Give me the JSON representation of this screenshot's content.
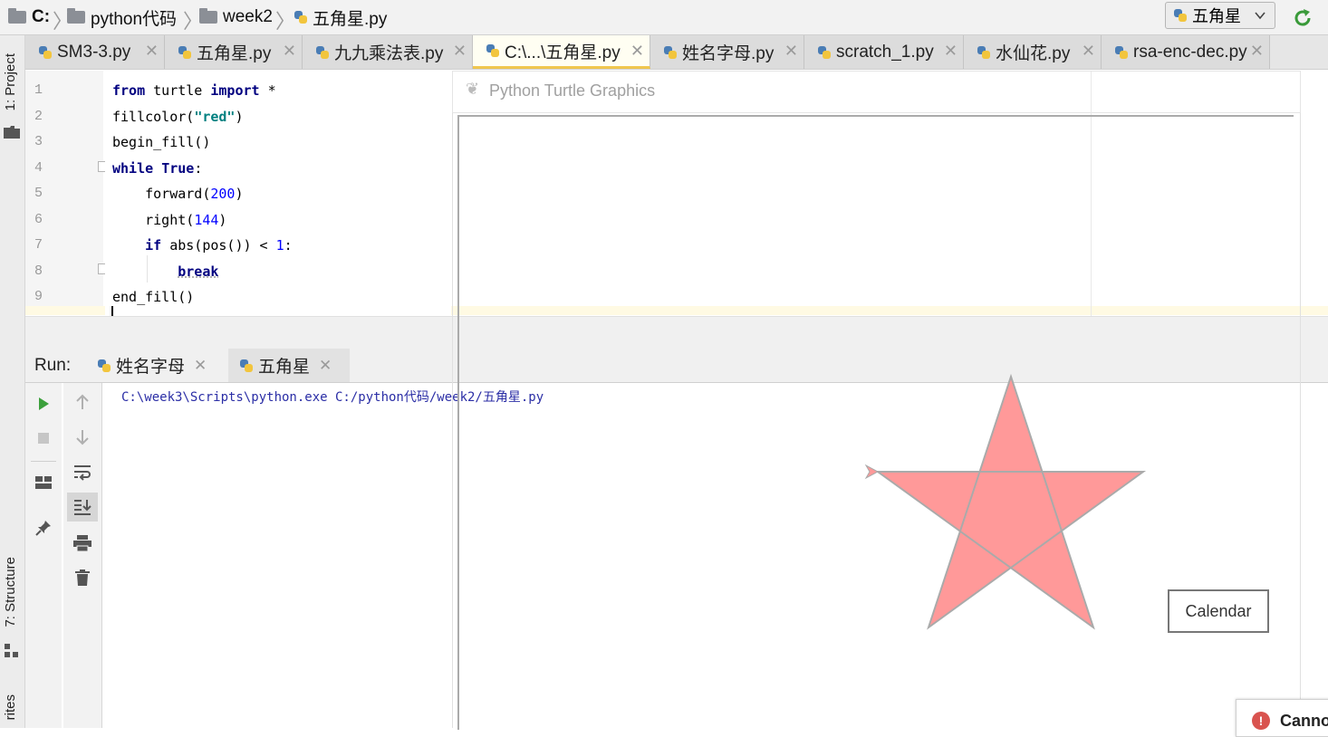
{
  "navbar": {
    "crumbs": [
      "C:",
      "python代码",
      "week2",
      "五角星.py"
    ],
    "run_config": "五角星"
  },
  "left_strip": {
    "project": "1: Project",
    "structure": "7: Structure",
    "favorites": "rites"
  },
  "tabs": [
    {
      "label": "SM3-3.py"
    },
    {
      "label": "五角星.py"
    },
    {
      "label": "九九乘法表.py"
    },
    {
      "label": "C:\\...\\五角星.py"
    },
    {
      "label": "姓名字母.py"
    },
    {
      "label": "scratch_1.py"
    },
    {
      "label": "水仙花.py"
    },
    {
      "label": "rsa-enc-dec.py"
    }
  ],
  "editor": {
    "line_numbers": [
      "1",
      "2",
      "3",
      "4",
      "5",
      "6",
      "7",
      "8",
      "9"
    ],
    "lines": {
      "l1": {
        "kw1": "from",
        "mid": " turtle ",
        "kw2": "import",
        "end": " *"
      },
      "l2": {
        "fn": "fillcolor(",
        "str": "\"red\"",
        "end": ")"
      },
      "l3": {
        "fn": "begin_fill()"
      },
      "l4": {
        "kw1": "while",
        "sp": " ",
        "kw2": "True",
        "end": ":"
      },
      "l5": {
        "fn": "    forward(",
        "num": "200",
        "end": ")"
      },
      "l6": {
        "fn": "    right(",
        "num": "144",
        "end": ")"
      },
      "l7": {
        "pre": "    ",
        "kw": "if",
        "mid": " abs(pos()) < ",
        "num": "1",
        "end": ":"
      },
      "l8": {
        "pre": "        ",
        "kw": "break"
      },
      "l9": {
        "fn": "end_fill()"
      }
    }
  },
  "run": {
    "label": "Run:",
    "tabs": [
      {
        "label": "姓名字母"
      },
      {
        "label": "五角星"
      }
    ],
    "console_line": "C:\\week3\\Scripts\\python.exe C:/python代码/week2/五角星.py"
  },
  "turtle": {
    "title": "Python Turtle Graphics",
    "fill_color": "#ff9999",
    "outline_color": "#aaaaaa",
    "calendar_label": "Calendar"
  },
  "notification": {
    "text": "Canno"
  }
}
